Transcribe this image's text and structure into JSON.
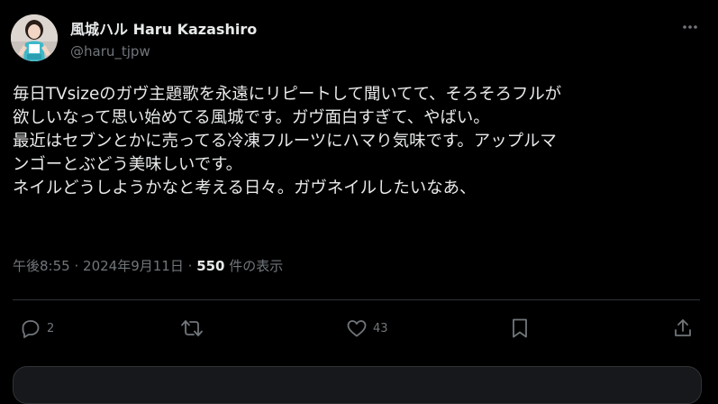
{
  "tweet": {
    "author": {
      "display_name": "風城ハル Haru Kazashiro",
      "handle": "@haru_tjpw"
    },
    "text_lines": [
      "毎日TVsizeのガヴ主題歌を永遠にリピートして聞いてて、そろそろフルが",
      "欲しいなって思い始めてる風城です。ガヴ面白すぎて、やばい。",
      "最近はセブンとかに売ってる冷凍フルーツにハマり気味です。アップルマ",
      "ンゴーとぶどう美味しいです。",
      "ネイルどうしようかなと考える日々。ガヴネイルしたいなあ、"
    ],
    "meta": {
      "time": "午後8:55",
      "separator": "·",
      "date": "2024年9月11日",
      "views_count": "550",
      "views_label": "件の表示"
    },
    "actions": {
      "reply_count": "2",
      "retweet_count": "",
      "like_count": "43"
    }
  },
  "icons": {
    "more": "more-dots-icon",
    "reply": "reply-bubble-icon",
    "retweet": "retweet-arrows-icon",
    "like": "heart-icon",
    "bookmark": "bookmark-icon",
    "share": "share-upload-icon"
  },
  "colors": {
    "background": "#000000",
    "text_primary": "#e7e9ea",
    "text_secondary": "#71767b",
    "divider": "#2f3336"
  }
}
